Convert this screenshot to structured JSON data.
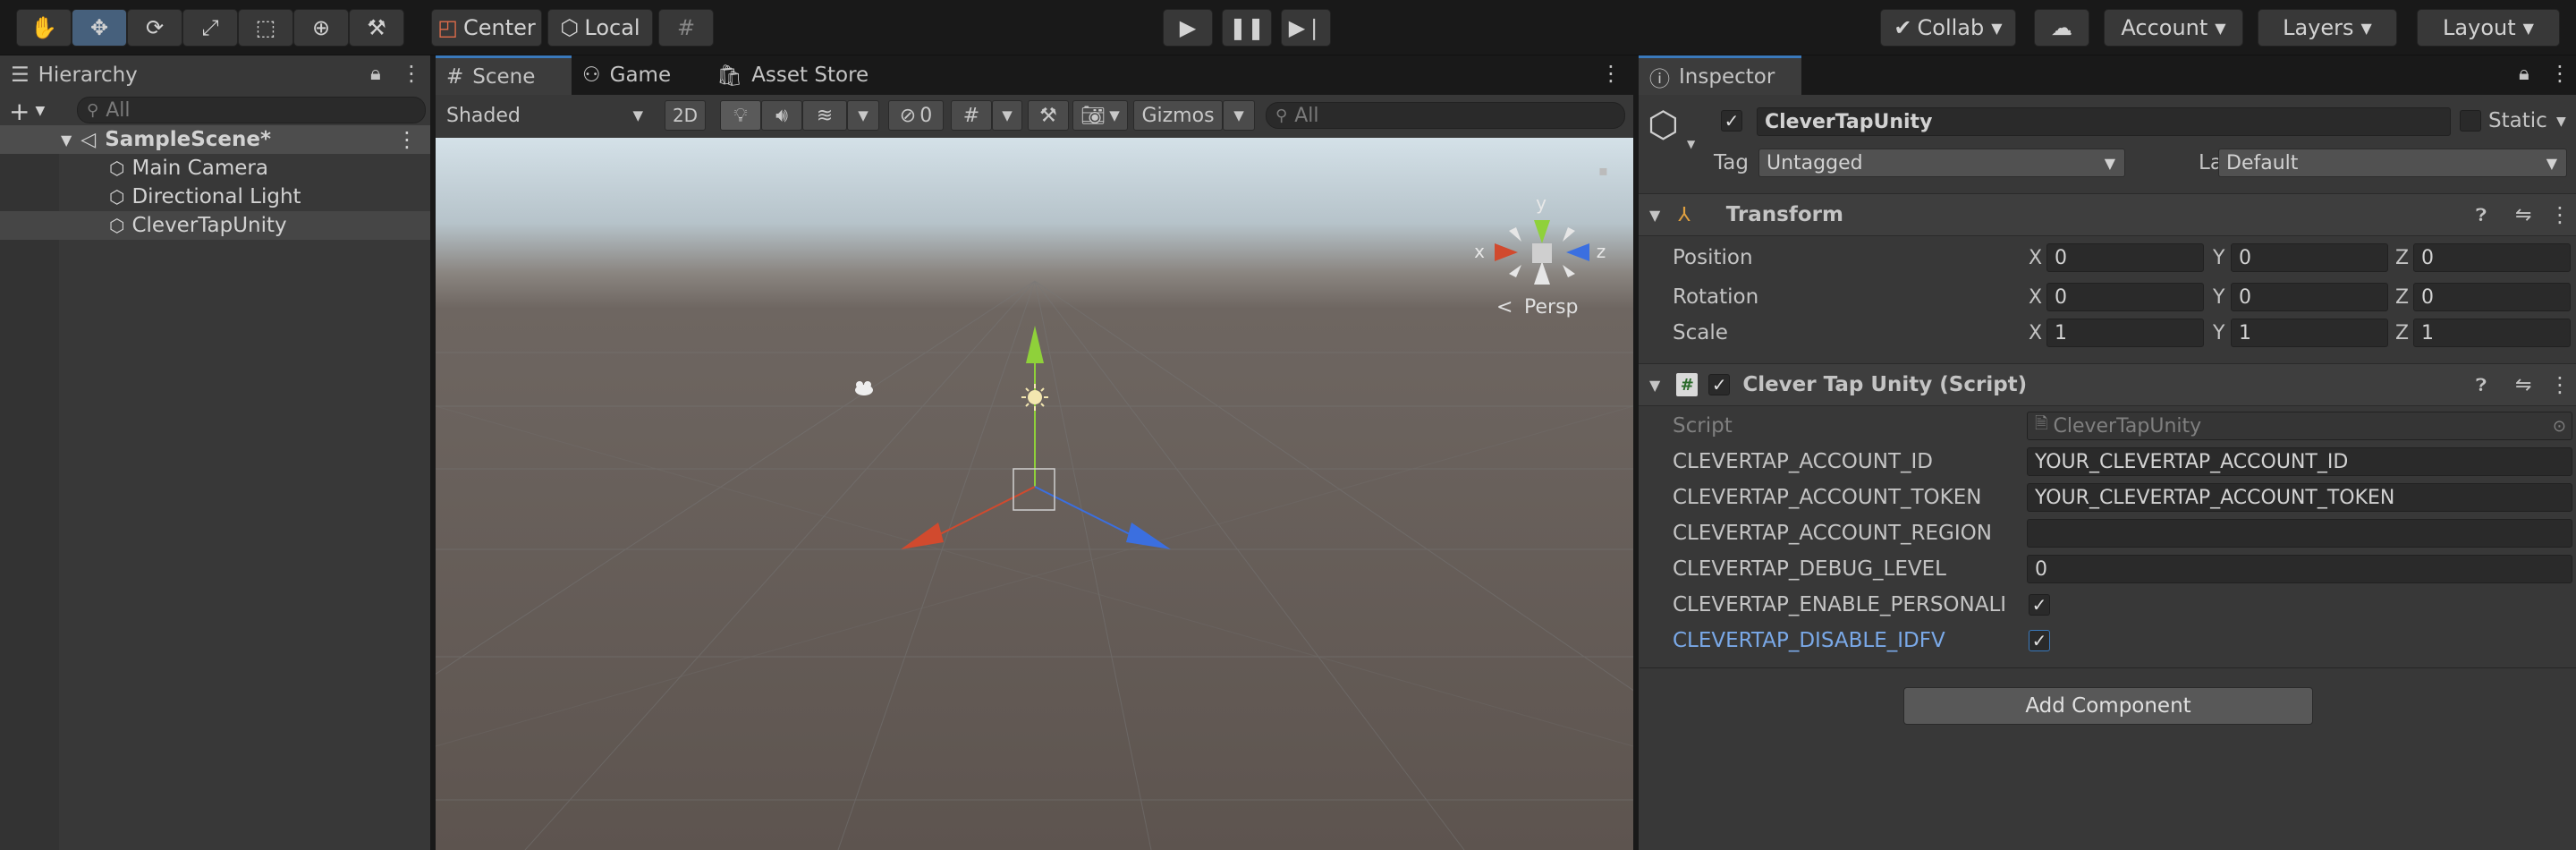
{
  "toolbar": {
    "pivot_label": "Center",
    "space_label": "Local",
    "collab_label": "Collab",
    "account_label": "Account",
    "layers_label": "Layers",
    "layout_label": "Layout"
  },
  "hierarchy": {
    "tab_label": "Hierarchy",
    "search_placeholder": "All",
    "scene_name": "SampleScene*",
    "items": [
      {
        "label": "Main Camera"
      },
      {
        "label": "Directional Light"
      },
      {
        "label": "CleverTapUnity"
      }
    ]
  },
  "scene_view": {
    "tabs": [
      {
        "label": "Scene"
      },
      {
        "label": "Game"
      },
      {
        "label": "Asset Store"
      }
    ],
    "draw_mode": "Shaded",
    "mode_2d": "2D",
    "hidden_count": "0",
    "gizmos_label": "Gizmos",
    "search_placeholder": "All",
    "axis_x": "x",
    "axis_y": "y",
    "axis_z": "z",
    "persp_label": "Persp"
  },
  "inspector": {
    "tab_label": "Inspector",
    "object_name": "CleverTapUnity",
    "static_label": "Static",
    "tag_label": "Tag",
    "tag_value": "Untagged",
    "layer_label": "Layer",
    "layer_value": "Default",
    "transform": {
      "title": "Transform",
      "rows": [
        {
          "label": "Position",
          "x": "0",
          "y": "0",
          "z": "0"
        },
        {
          "label": "Rotation",
          "x": "0",
          "y": "0",
          "z": "0"
        },
        {
          "label": "Scale",
          "x": "1",
          "y": "1",
          "z": "1"
        }
      ]
    },
    "script_component": {
      "title": "Clever Tap Unity (Script)",
      "script_label": "Script",
      "script_value": "CleverTapUnity",
      "fields": [
        {
          "label": "CLEVERTAP_ACCOUNT_ID",
          "value": "YOUR_CLEVERTAP_ACCOUNT_ID"
        },
        {
          "label": "CLEVERTAP_ACCOUNT_TOKEN",
          "value": "YOUR_CLEVERTAP_ACCOUNT_TOKEN"
        },
        {
          "label": "CLEVERTAP_ACCOUNT_REGION",
          "value": ""
        },
        {
          "label": "CLEVERTAP_DEBUG_LEVEL",
          "value": "0"
        },
        {
          "label": "CLEVERTAP_ENABLE_PERSONALI",
          "checked": true
        },
        {
          "label": "CLEVERTAP_DISABLE_IDFV",
          "checked": true
        }
      ]
    },
    "add_component_label": "Add Component"
  },
  "labels": {
    "x": "X",
    "y": "Y",
    "z": "Z"
  },
  "colors": {
    "accent": "#3a79bb",
    "axis_x": "#d14a2e",
    "axis_y": "#8fd13a",
    "axis_z": "#3b6fe0",
    "highlight_label": "#7aa9e8"
  },
  "icons": [
    "hand-icon",
    "move-icon",
    "rotate-icon",
    "scale-icon",
    "rect-icon",
    "transform-icon",
    "custom-tool-icon",
    "play-icon",
    "pause-icon",
    "step-icon",
    "cloud-icon",
    "lock-icon",
    "menu-dots-icon",
    "help-icon",
    "preset-icon",
    "settings-icon"
  ]
}
